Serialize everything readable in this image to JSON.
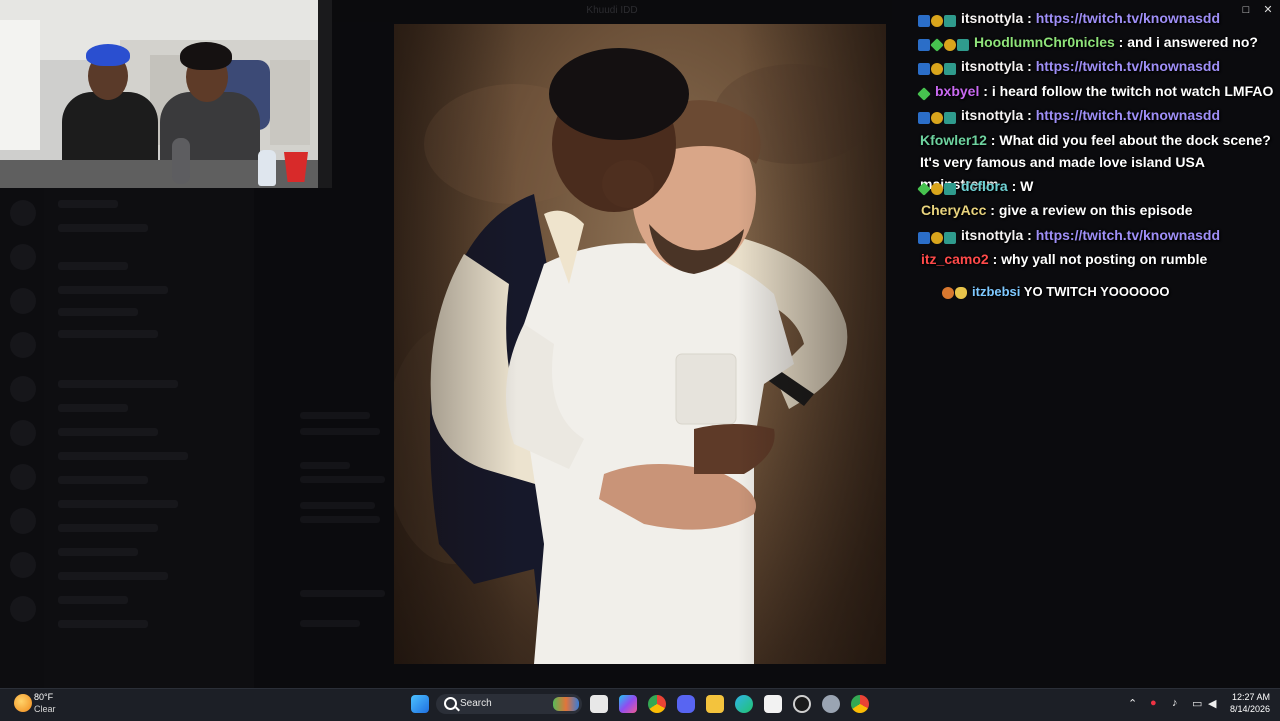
{
  "background_window": {
    "title": "Khuudi IDD"
  },
  "chat": {
    "messages": [
      {
        "badges": [
          "b-blue",
          "b-gold",
          "b-teal"
        ],
        "user": "itsnottyla",
        "user_color": "#f5f2f2",
        "sep": " : ",
        "text": "https://twitch.tv/knownasdd",
        "is_link": true
      },
      {
        "badges": [
          "b-blue",
          "b-green",
          "b-gold",
          "b-teal"
        ],
        "user": "HoodlumnChr0nicles",
        "user_color": "#8fe37a",
        "sep": " : ",
        "text": "and i answered no?",
        "is_link": false
      },
      {
        "badges": [
          "b-blue",
          "b-gold",
          "b-teal"
        ],
        "user": "itsnottyla",
        "user_color": "#f5f2f2",
        "sep": " : ",
        "text": "https://twitch.tv/knownasdd",
        "is_link": true
      },
      {
        "badges": [
          "b-green"
        ],
        "user": "bxbyel",
        "user_color": "#c869f0",
        "sep": " : ",
        "text": "i heard follow the twitch not watch LMFAO",
        "is_link": false
      },
      {
        "badges": [
          "b-blue",
          "b-gold",
          "b-teal"
        ],
        "user": "itsnottyla",
        "user_color": "#f5f2f2",
        "sep": " : ",
        "text": "https://twitch.tv/knownasdd",
        "is_link": true
      },
      {
        "badges": [],
        "user": "Kfowler12",
        "user_color": "#6ed3a0",
        "sep": " : ",
        "text": "What did you feel about the dock scene? It's very famous and made love island USA mainstream",
        "is_link": false
      },
      {
        "badges": [
          "b-green",
          "b-gold",
          "b-teal"
        ],
        "user": "dcflora",
        "user_color": "#6fd3d6",
        "sep": " : ",
        "text": "W",
        "is_link": false
      },
      {
        "badges": [],
        "user": "CheryAcc",
        "user_color": "#e8d37e",
        "sep": " : ",
        "text": "give a review on this episode",
        "is_link": false
      },
      {
        "badges": [
          "b-blue",
          "b-gold",
          "b-teal"
        ],
        "user": "itsnottyla",
        "user_color": "#f5f2f2",
        "sep": " : ",
        "text": "https://twitch.tv/knownasdd",
        "is_link": true
      },
      {
        "badges": [],
        "user": "itz_camo2",
        "user_color": "#ff4a4a",
        "sep": " : ",
        "text": "why yall not posting on rumble",
        "is_link": false
      },
      {
        "badges": [
          "b-orange",
          "b-yellow"
        ],
        "user": "itzbebsi",
        "user_color": "#7ec8ff",
        "sep": " ",
        "text": "YO TWITCH YOOOOOO",
        "is_link": false
      }
    ]
  },
  "taskbar": {
    "weather_temp": "80°F",
    "weather_condition": "Clear",
    "search_label": "Search",
    "clock_time": "12:27 AM",
    "clock_date": "8/14/2026"
  }
}
